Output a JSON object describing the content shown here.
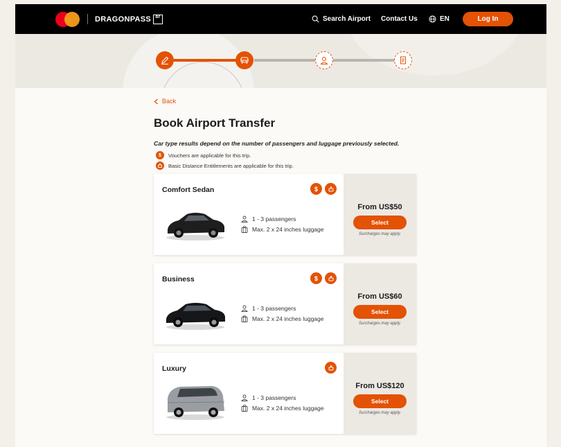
{
  "header": {
    "brand": "DRAGONPASS",
    "brand_mark": "ar",
    "search_label": "Search Airport",
    "contact_label": "Contact Us",
    "language_label": "EN",
    "login_label": "Log In",
    "accent_color": "#e35205"
  },
  "progress": {
    "steps": [
      {
        "icon": "pencil-icon",
        "state": "done"
      },
      {
        "icon": "car-icon",
        "state": "current"
      },
      {
        "icon": "person-icon",
        "state": "pending"
      },
      {
        "icon": "document-icon",
        "state": "pending"
      }
    ]
  },
  "page": {
    "back_label": "Back",
    "title": "Book Airport Transfer",
    "notice": "Car type results depend on the number of passengers and luggage previously selected.",
    "voucher_info": "Vouchers are applicable for this trip.",
    "entitlement_info": "Basic Distance Entitlements are applicable for this trip."
  },
  "cars": [
    {
      "name": "Comfort Sedan",
      "passengers": "1 - 3 passengers",
      "luggage": "Max. 2 x 24 inches luggage",
      "price": "From US$50",
      "select_label": "Select",
      "surcharge": "Surcharges may apply.",
      "perks": [
        "voucher-icon",
        "entitlement-icon"
      ]
    },
    {
      "name": "Business",
      "passengers": "1 - 3 passengers",
      "luggage": "Max. 2 x 24 inches luggage",
      "price": "From US$60",
      "select_label": "Select",
      "surcharge": "Surcharges may apply.",
      "perks": [
        "voucher-icon",
        "entitlement-icon"
      ]
    },
    {
      "name": "Luxury",
      "passengers": "1 - 3 passengers",
      "luggage": "Max. 2 x 24 inches luggage",
      "price": "From US$120",
      "select_label": "Select",
      "surcharge": "Surcharges may apply.",
      "perks": [
        "entitlement-icon"
      ]
    }
  ]
}
